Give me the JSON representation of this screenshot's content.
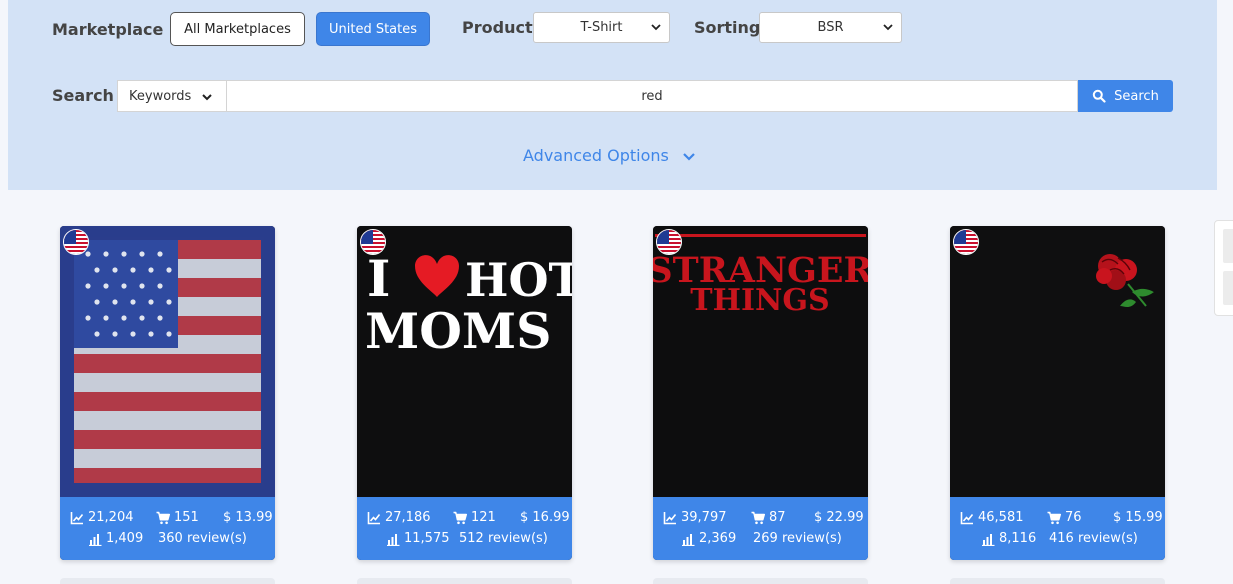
{
  "filters": {
    "marketplace_label": "Marketplace",
    "marketplace_all": "All Marketplaces",
    "marketplace_us": "United States",
    "product_label": "Product",
    "product_value": "T-Shirt",
    "sorting_label": "Sorting",
    "sorting_value": "BSR",
    "search_label": "Search",
    "search_type": "Keywords",
    "search_value": "red",
    "search_button": "Search",
    "advanced_options": "Advanced Options"
  },
  "products": [
    {
      "bsr": "21,204",
      "sales": "151",
      "price": "$ 13.99",
      "rank": "1,409",
      "reviews": "360 review(s)"
    },
    {
      "bsr": "27,186",
      "sales": "121",
      "price": "$ 16.99",
      "rank": "11,575",
      "reviews": "512 review(s)",
      "graphic_text": [
        "I",
        "HOT",
        "MOMS"
      ]
    },
    {
      "bsr": "39,797",
      "sales": "87",
      "price": "$ 22.99",
      "rank": "2,369",
      "reviews": "269 review(s)",
      "graphic_text": [
        "STRANGER",
        "THINGS"
      ]
    },
    {
      "bsr": "46,581",
      "sales": "76",
      "price": "$ 15.99",
      "rank": "8,116",
      "reviews": "416 review(s)"
    }
  ],
  "colors": {
    "accent": "#3f86e8",
    "panel": "#d3e2f6"
  }
}
